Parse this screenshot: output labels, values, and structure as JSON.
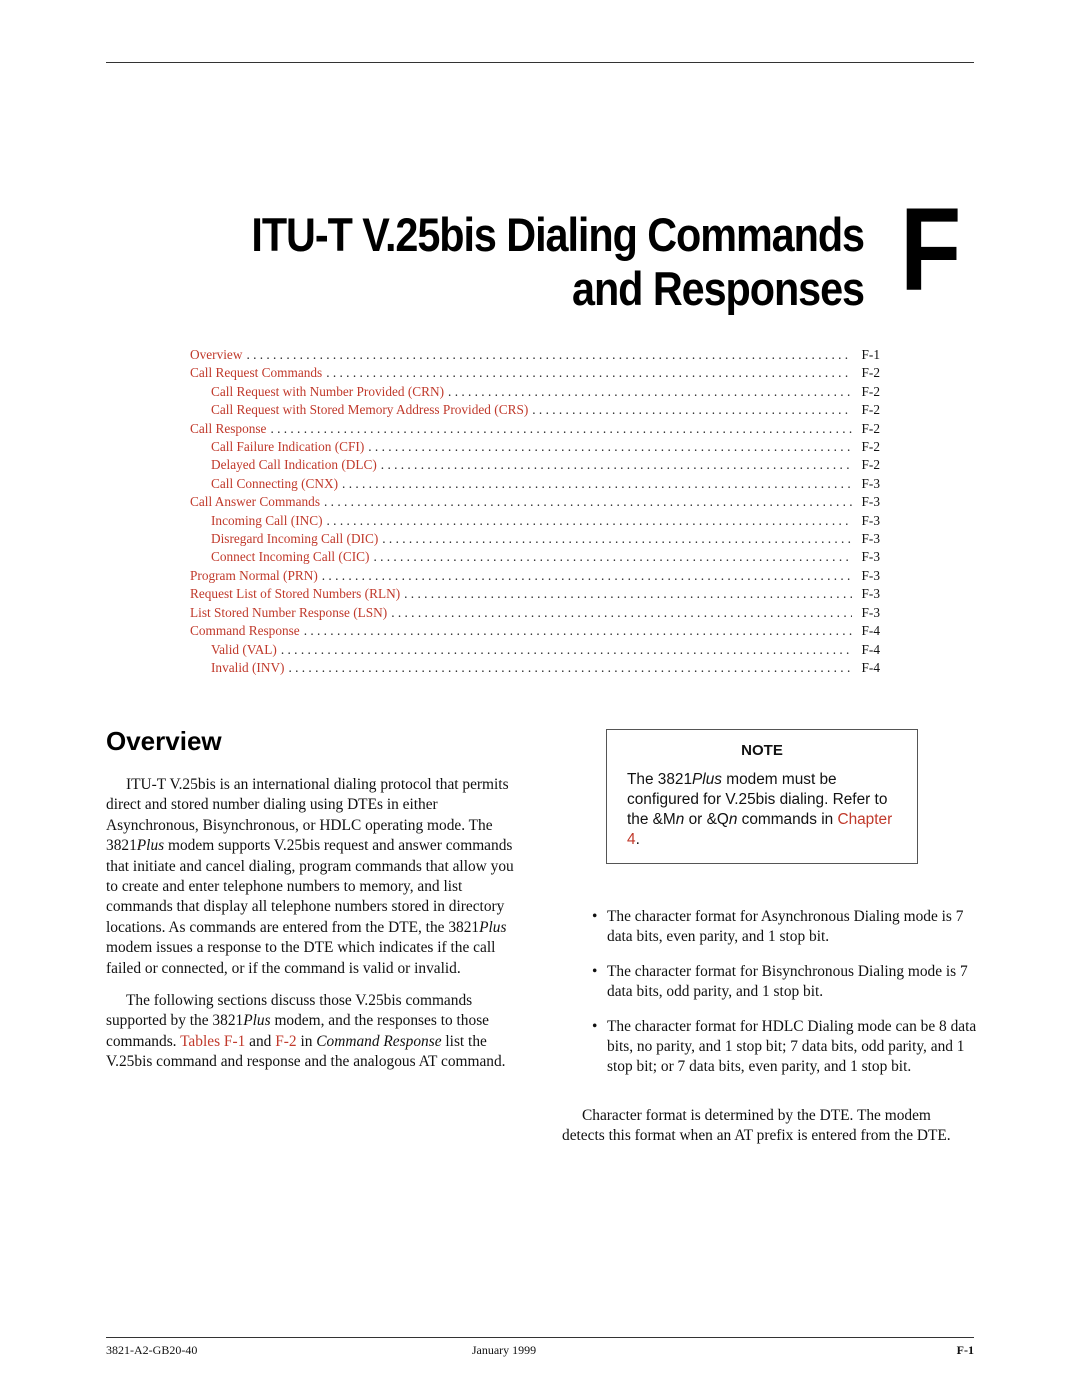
{
  "header": {
    "title_line1": "ITU-T V.25bis Dialing Commands",
    "title_line2": "and Responses",
    "chapter_letter": "F"
  },
  "toc": [
    {
      "label": "Overview",
      "page": "F-1",
      "level": 1
    },
    {
      "label": "Call Request Commands",
      "page": "F-2",
      "level": 1
    },
    {
      "label": "Call Request with Number Provided (CRN)",
      "page": "F-2",
      "level": 2
    },
    {
      "label": "Call Request with Stored Memory Address Provided (CRS)",
      "page": "F-2",
      "level": 2
    },
    {
      "label": "Call Response",
      "page": "F-2",
      "level": 1
    },
    {
      "label": "Call Failure Indication (CFI)",
      "page": "F-2",
      "level": 2
    },
    {
      "label": "Delayed Call Indication (DLC)",
      "page": "F-2",
      "level": 2
    },
    {
      "label": "Call Connecting (CNX)",
      "page": "F-3",
      "level": 2
    },
    {
      "label": "Call Answer Commands",
      "page": "F-3",
      "level": 1
    },
    {
      "label": "Incoming Call (INC)",
      "page": "F-3",
      "level": 2
    },
    {
      "label": "Disregard Incoming Call (DIC)",
      "page": "F-3",
      "level": 2
    },
    {
      "label": "Connect Incoming Call (CIC)",
      "page": "F-3",
      "level": 2
    },
    {
      "label": "Program Normal (PRN)",
      "page": "F-3",
      "level": 1
    },
    {
      "label": "Request List of Stored Numbers (RLN)",
      "page": "F-3",
      "level": 1
    },
    {
      "label": "List Stored Number Response (LSN)",
      "page": "F-3",
      "level": 1
    },
    {
      "label": "Command Response",
      "page": "F-4",
      "level": 1
    },
    {
      "label": "Valid (VAL)",
      "page": "F-4",
      "level": 2
    },
    {
      "label": "Invalid (INV)",
      "page": "F-4",
      "level": 2
    }
  ],
  "overview": {
    "heading": "Overview",
    "p1": {
      "a": "ITU-T V.25bis is an international dialing protocol that permits direct and stored number dialing using DTEs in either Asynchronous, Bisynchronous, or HDLC operating mode. The 3821",
      "plus1": "Plus",
      "b": " modem supports V.25bis request and answer commands that initiate and cancel dialing, program commands that allow you to create and enter telephone numbers to memory, and list commands that display all telephone numbers stored in directory locations. As commands are entered from the DTE, the 3821",
      "plus2": "Plus",
      "c": " modem issues a response to the DTE which indicates if the call failed or connected, or if the command is valid or invalid."
    },
    "p2": {
      "a": "The following sections discuss those V.25bis commands supported by the 3821",
      "plus": "Plus",
      "b": " modem, and the responses to those commands. ",
      "link1": "Tables F-1",
      "c": " and ",
      "link2": "F-2",
      "d": " in ",
      "em": "Command Response",
      "e": " list the V.25bis command and response and the analogous AT command."
    }
  },
  "note": {
    "title": "NOTE",
    "a": "The 3821",
    "plus": "Plus",
    "b": " modem must be configured for V.25bis dialing. Refer to the &M",
    "n1": "n",
    "c": " or &Q",
    "n2": "n",
    "d": " commands in ",
    "link": "Chapter 4",
    "e": "."
  },
  "bullets": [
    "The character format for Asynchronous Dialing mode is 7 data bits, even parity, and 1 stop bit.",
    "The character format for Bisynchronous Dialing mode is 7 data bits, odd parity, and 1 stop bit.",
    "The character format for HDLC Dialing mode can be 8 data bits, no parity, and 1 stop bit; 7 data bits, odd parity, and 1 stop bit; or 7 data bits, even parity, and 1 stop bit."
  ],
  "bullet_glyph": "•",
  "closing_paragraph": "Character format is determined by the DTE. The modem detects this format when an AT prefix is entered from the DTE.",
  "footer": {
    "doc_number": "3821-A2-GB20-40",
    "date": "January 1999",
    "page": "F-1"
  }
}
